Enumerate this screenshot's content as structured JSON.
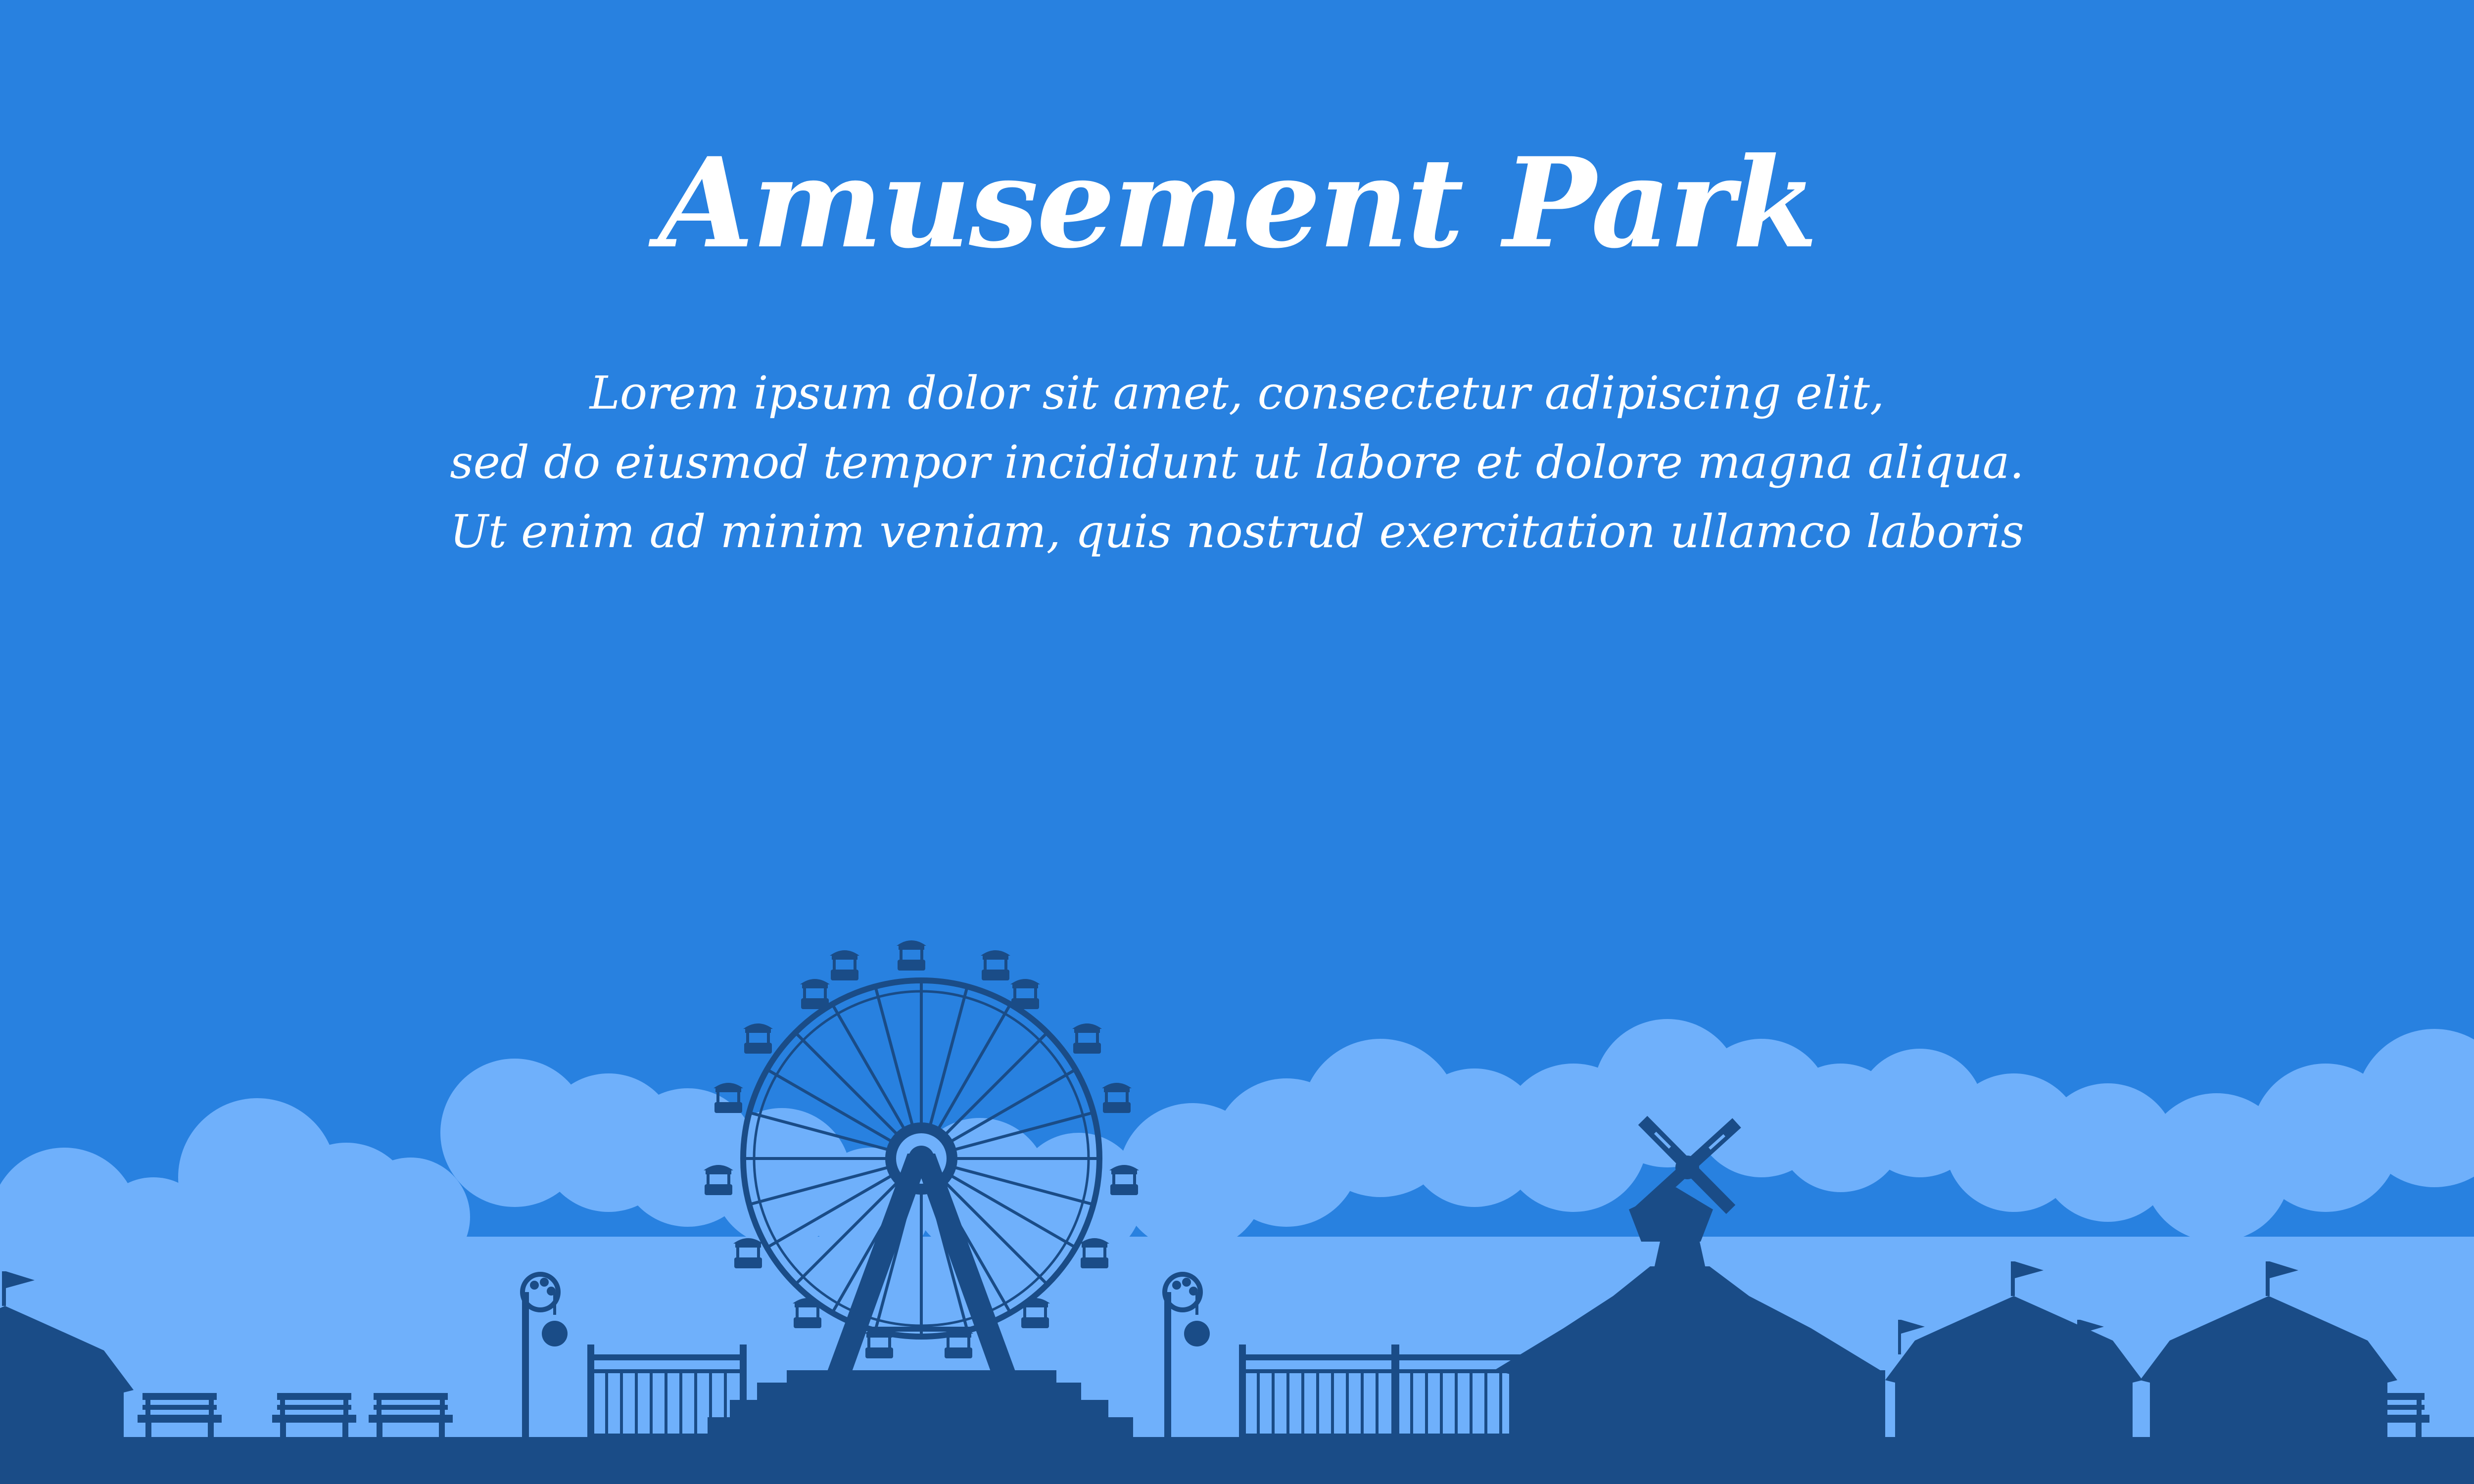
{
  "title": "Amusement Park",
  "body_lines": [
    "Lorem ipsum dolor sit amet, consectetur adipiscing elit,",
    "sed do eiusmod tempor incididunt ut labore et dolore magna aliqua.",
    "Ut enim ad minim veniam, quis nostrud exercitation ullamco laboris"
  ],
  "colors": {
    "sky": "#2881e0",
    "clouds": "#6fb0fb",
    "silhouette": "#1a4c87",
    "text": "#ffffff"
  }
}
